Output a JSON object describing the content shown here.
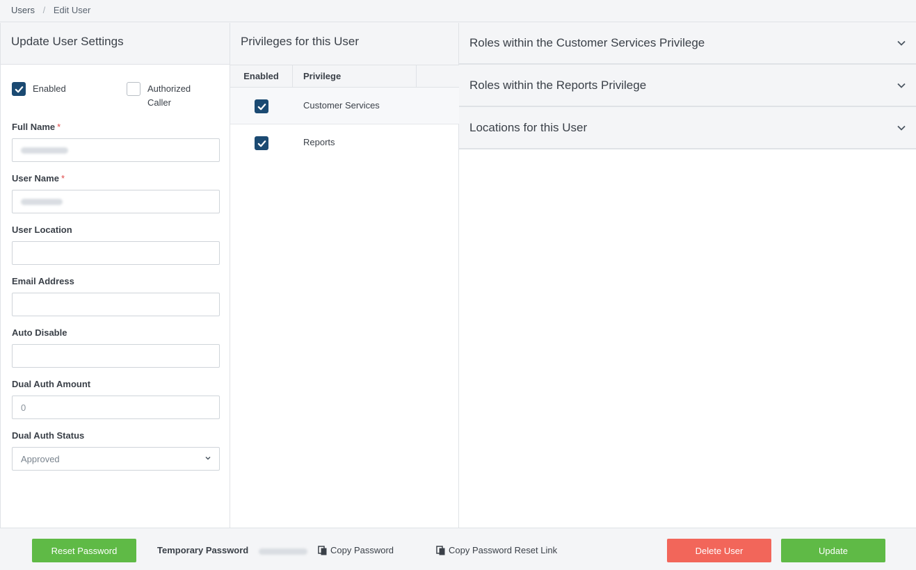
{
  "breadcrumb": {
    "items": [
      "Users",
      "Edit User"
    ]
  },
  "left_panel": {
    "title": "Update User Settings",
    "checkboxes": [
      {
        "label": "Enabled",
        "checked": true
      },
      {
        "label": "Authorized Caller",
        "checked": false
      }
    ],
    "fields": {
      "full_name": {
        "label": "Full Name",
        "required": "*",
        "value": ""
      },
      "user_name": {
        "label": "User Name",
        "required": "*",
        "value": ""
      },
      "user_location": {
        "label": "User Location",
        "value": ""
      },
      "email": {
        "label": "Email Address",
        "value": ""
      },
      "auto_disable": {
        "label": "Auto Disable",
        "value": ""
      },
      "dual_auth_amount": {
        "label": "Dual Auth Amount",
        "placeholder": "0"
      },
      "dual_auth_status": {
        "label": "Dual Auth Status",
        "value": "Approved"
      }
    }
  },
  "mid_panel": {
    "title": "Privileges for this User",
    "columns": [
      "Enabled",
      "Privilege"
    ],
    "rows": [
      {
        "name": "Customer Services",
        "enabled": true
      },
      {
        "name": "Reports",
        "enabled": true
      }
    ]
  },
  "right_panel": {
    "sections": [
      "Roles within the Customer Services Privilege",
      "Roles within the Reports Privilege",
      "Locations for this User"
    ]
  },
  "footer": {
    "reset_password": "Reset Password",
    "temp_password_label": "Temporary Password",
    "copy_password": "Copy Password",
    "copy_reset_link": "Copy Password Reset Link",
    "delete_user": "Delete User",
    "update": "Update"
  },
  "colors": {
    "primary": "#1b4a72",
    "success": "#5fba46",
    "danger": "#f2665a",
    "required": "#e04848"
  }
}
